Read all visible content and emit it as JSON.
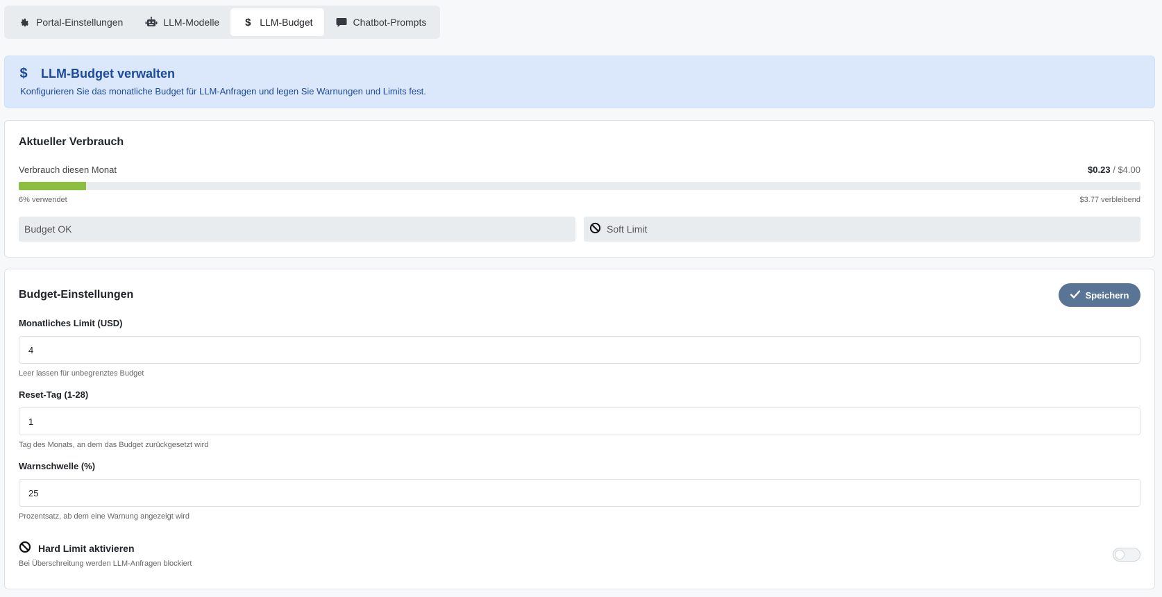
{
  "tabs": [
    {
      "label": "Portal-Einstellungen",
      "icon": "gear-icon"
    },
    {
      "label": "LLM-Modelle",
      "icon": "robot-icon"
    },
    {
      "label": "LLM-Budget",
      "icon": "dollar-icon",
      "active": true
    },
    {
      "label": "Chatbot-Prompts",
      "icon": "chat-icon"
    }
  ],
  "banner": {
    "icon": "dollar-icon",
    "title": "LLM-Budget verwalten",
    "subtitle": "Konfigurieren Sie das monatliche Budget für LLM-Anfragen und legen Sie Warnungen und Limits fest."
  },
  "usage": {
    "title": "Aktueller Verbrauch",
    "label": "Verbrauch diesen Monat",
    "spent": "$0.23",
    "separator": "/",
    "limit": "$4.00",
    "progress_fraction": 0.06,
    "used_text": "6% verwendet",
    "remaining_text": "$3.77 verbleibend",
    "status_ok": "Budget OK",
    "status_soft": "Soft Limit",
    "status_soft_icon": "ban-icon",
    "colors": {
      "progress": "#8cbf3f"
    }
  },
  "settings": {
    "title": "Budget-Einstellungen",
    "save_label": "Speichern",
    "save_icon": "check-icon",
    "monthly_limit": {
      "label": "Monatliches Limit (USD)",
      "value": "4",
      "help": "Leer lassen für unbegrenztes Budget"
    },
    "reset_day": {
      "label": "Reset-Tag (1-28)",
      "value": "1",
      "help": "Tag des Monats, an dem das Budget zurückgesetzt wird"
    },
    "warn_threshold": {
      "label": "Warnschwelle (%)",
      "value": "25",
      "help": "Prozentsatz, ab dem eine Warnung angezeigt wird"
    },
    "hard_limit": {
      "label": "Hard Limit aktivieren",
      "help": "Bei Überschreitung werden LLM-Anfragen blockiert",
      "icon": "ban-icon",
      "enabled": false
    }
  },
  "colors": {
    "accent": "#1c4a9a",
    "banner_bg": "#dbe8fb",
    "save_button": "#5a7495"
  }
}
